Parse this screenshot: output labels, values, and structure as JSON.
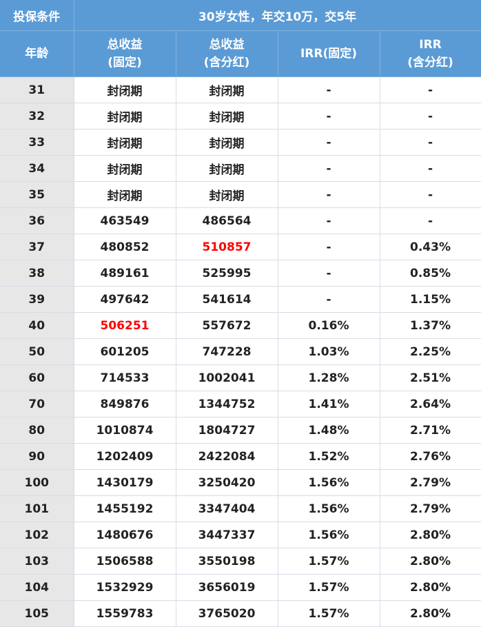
{
  "header": {
    "condition_label": "投保条件",
    "condition_value": "30岁女性，年交10万，交5年",
    "col_age": "年龄",
    "col_fixed_l1": "总收益",
    "col_fixed_l2": "(固定)",
    "col_div_l1": "总收益",
    "col_div_l2": "(含分红)",
    "col_irr_fixed": "IRR(固定)",
    "col_irr_div_l1": "IRR",
    "col_irr_div_l2": "(含分红)"
  },
  "highlight_color": "#ff0000",
  "rows": [
    {
      "age": "31",
      "fixed": "封闭期",
      "div": "封闭期",
      "irr_fixed": "-",
      "irr_div": "-"
    },
    {
      "age": "32",
      "fixed": "封闭期",
      "div": "封闭期",
      "irr_fixed": "-",
      "irr_div": "-"
    },
    {
      "age": "33",
      "fixed": "封闭期",
      "div": "封闭期",
      "irr_fixed": "-",
      "irr_div": "-"
    },
    {
      "age": "34",
      "fixed": "封闭期",
      "div": "封闭期",
      "irr_fixed": "-",
      "irr_div": "-"
    },
    {
      "age": "35",
      "fixed": "封闭期",
      "div": "封闭期",
      "irr_fixed": "-",
      "irr_div": "-"
    },
    {
      "age": "36",
      "fixed": "463549",
      "div": "486564",
      "irr_fixed": "-",
      "irr_div": "-"
    },
    {
      "age": "37",
      "fixed": "480852",
      "div": "510857",
      "irr_fixed": "-",
      "irr_div": "0.43%",
      "red": "div"
    },
    {
      "age": "38",
      "fixed": "489161",
      "div": "525995",
      "irr_fixed": "-",
      "irr_div": "0.85%"
    },
    {
      "age": "39",
      "fixed": "497642",
      "div": "541614",
      "irr_fixed": "-",
      "irr_div": "1.15%"
    },
    {
      "age": "40",
      "fixed": "506251",
      "div": "557672",
      "irr_fixed": "0.16%",
      "irr_div": "1.37%",
      "red": "fixed"
    },
    {
      "age": "50",
      "fixed": "601205",
      "div": "747228",
      "irr_fixed": "1.03%",
      "irr_div": "2.25%"
    },
    {
      "age": "60",
      "fixed": "714533",
      "div": "1002041",
      "irr_fixed": "1.28%",
      "irr_div": "2.51%"
    },
    {
      "age": "70",
      "fixed": "849876",
      "div": "1344752",
      "irr_fixed": "1.41%",
      "irr_div": "2.64%"
    },
    {
      "age": "80",
      "fixed": "1010874",
      "div": "1804727",
      "irr_fixed": "1.48%",
      "irr_div": "2.71%"
    },
    {
      "age": "90",
      "fixed": "1202409",
      "div": "2422084",
      "irr_fixed": "1.52%",
      "irr_div": "2.76%"
    },
    {
      "age": "100",
      "fixed": "1430179",
      "div": "3250420",
      "irr_fixed": "1.56%",
      "irr_div": "2.79%"
    },
    {
      "age": "101",
      "fixed": "1455192",
      "div": "3347404",
      "irr_fixed": "1.56%",
      "irr_div": "2.79%"
    },
    {
      "age": "102",
      "fixed": "1480676",
      "div": "3447337",
      "irr_fixed": "1.56%",
      "irr_div": "2.80%"
    },
    {
      "age": "103",
      "fixed": "1506588",
      "div": "3550198",
      "irr_fixed": "1.57%",
      "irr_div": "2.80%"
    },
    {
      "age": "104",
      "fixed": "1532929",
      "div": "3656019",
      "irr_fixed": "1.57%",
      "irr_div": "2.80%"
    },
    {
      "age": "105",
      "fixed": "1559783",
      "div": "3765020",
      "irr_fixed": "1.57%",
      "irr_div": "2.80%"
    }
  ]
}
